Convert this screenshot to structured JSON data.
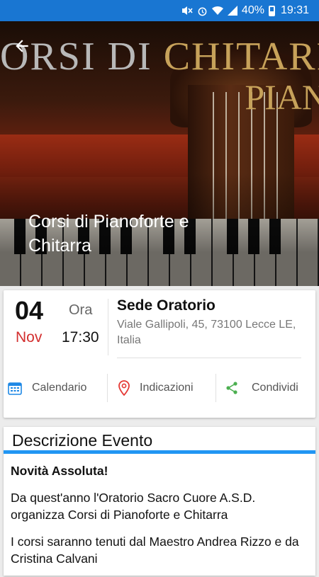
{
  "status_bar": {
    "battery_percent": "40%",
    "time": "19:31"
  },
  "hero": {
    "banner_line1_grey": "ORSI DI ",
    "banner_line1_gold": "CHITARRA",
    "banner_line2": "PIAN",
    "title": "Corsi di Pianoforte e Chitarra"
  },
  "event": {
    "day": "04",
    "month": "Nov",
    "time_label": "Ora",
    "time": "17:30",
    "venue": "Sede Oratorio",
    "address": "Viale Gallipoli, 45, 73100 Lecce LE, Italia",
    "actions": {
      "calendar": "Calendario",
      "directions": "Indicazioni",
      "share": "Condividi"
    }
  },
  "description": {
    "title": "Descrizione Evento",
    "headline": "Novità Assoluta!",
    "paragraph1": "Da quest'anno l'Oratorio Sacro Cuore A.S.D. organizza Corsi di Pianoforte e Chitarra",
    "paragraph2": "I corsi saranno tenuti dal Maestro Andrea Rizzo e da Cristina Calvani"
  },
  "colors": {
    "status_bar": "#1976d2",
    "accent": "#2196f3",
    "month": "#d32f2f",
    "share_icon": "#4caf50",
    "directions_icon": "#e53935",
    "calendar_icon": "#1e88e5"
  },
  "icons": [
    "mute-icon",
    "alarm-icon",
    "wifi-icon",
    "signal-icon",
    "battery-icon",
    "back-arrow-icon",
    "calendar-icon",
    "location-pin-icon",
    "share-icon"
  ]
}
